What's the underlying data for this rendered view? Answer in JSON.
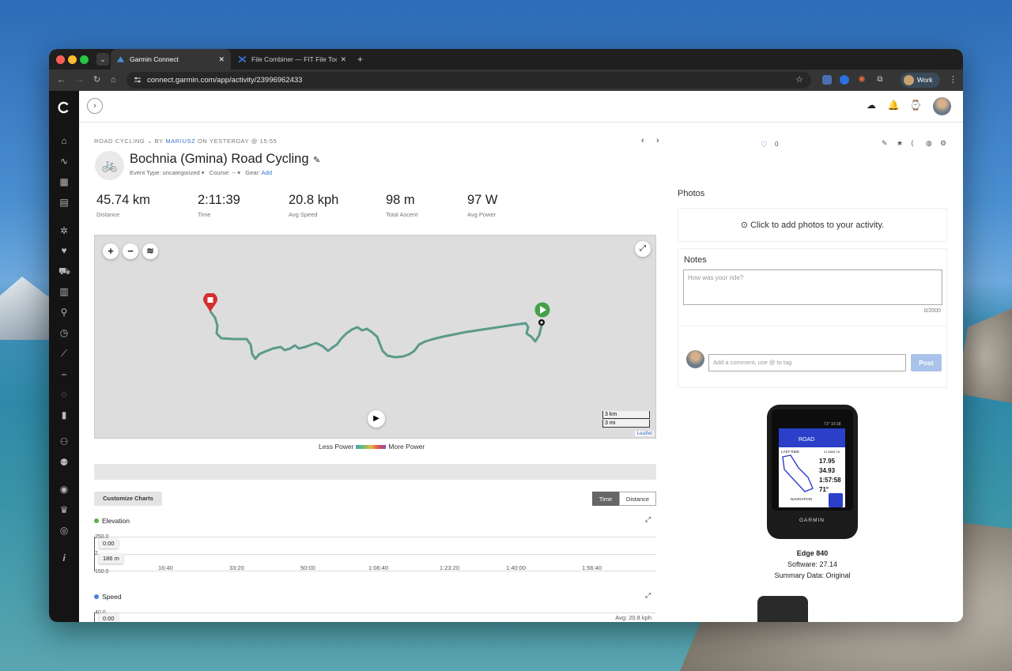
{
  "browser": {
    "tabs": [
      {
        "title": "Garmin Connect",
        "active": true
      },
      {
        "title": "File Combiner — FIT File Tools",
        "active": false
      }
    ],
    "url": "connect.garmin.com/app/activity/23996962433",
    "profile_name": "Work"
  },
  "activity": {
    "type": "ROAD CYCLING",
    "by": "BY",
    "author": "MARIUSZ",
    "when": "ON YESTERDAY @ 15:55",
    "title": "Bochnia (Gmina) Road Cycling",
    "event_type": "Event Type: uncategorized",
    "course": "Course: --",
    "gear_label": "Gear:",
    "gear_link": "Add",
    "likes": "0"
  },
  "stats": [
    {
      "value": "45.74 km",
      "label": "Distance"
    },
    {
      "value": "2:11:39",
      "label": "Time"
    },
    {
      "value": "20.8 kph",
      "label": "Avg Speed"
    },
    {
      "value": "98 m",
      "label": "Total Ascent"
    },
    {
      "value": "97 W",
      "label": "Avg Power"
    }
  ],
  "map": {
    "scale_km": "3 km",
    "scale_mi": "3 mi",
    "attribution": "Leaflet",
    "legend_less": "Less Power",
    "legend_more": "More Power"
  },
  "charts": {
    "customize": "Customize Charts",
    "toggle": [
      "Time",
      "Distance"
    ],
    "toggle_selected": "Time",
    "elevation": {
      "title": "Elevation",
      "y_top": "250.0",
      "y_bottom": "150.0",
      "y_mid": "2",
      "tooltip_time": "0:00",
      "tooltip_value": "186 m",
      "x_ticks": [
        "16:40",
        "33:20",
        "50:00",
        "1:06:40",
        "1:23:20",
        "1:40:00",
        "1:56:40"
      ]
    },
    "speed": {
      "title": "Speed",
      "y_top": "40.0",
      "tooltip_time": "0:00",
      "avg": "Avg: 20.8 kph"
    }
  },
  "panel": {
    "photos_title": "Photos",
    "photos_cta": "Click to add photos to your activity.",
    "notes_title": "Notes",
    "notes_placeholder": "How was your ride?",
    "notes_count": "0/2000",
    "comment_placeholder": "Add a comment, use @ to tag",
    "post": "Post"
  },
  "device": {
    "name": "Edge 840",
    "software": "Software: 27.14",
    "summary": "Summary Data: Original",
    "screen_mode": "ROAD",
    "screen_time": "71° 10:18",
    "screen_card": "LAST RIDE",
    "screen_date": "21 MAR 23",
    "screen_values": [
      "17.95",
      "34.93",
      "1:57:58",
      "71°"
    ],
    "screen_nav": "NAVIGATION",
    "brand": "GARMIN"
  },
  "colors": {
    "accent": "#3a73c7",
    "route": "#5b9a8a",
    "start": "#43a047",
    "end": "#d32f2f",
    "post_button": "#aac3ea"
  }
}
